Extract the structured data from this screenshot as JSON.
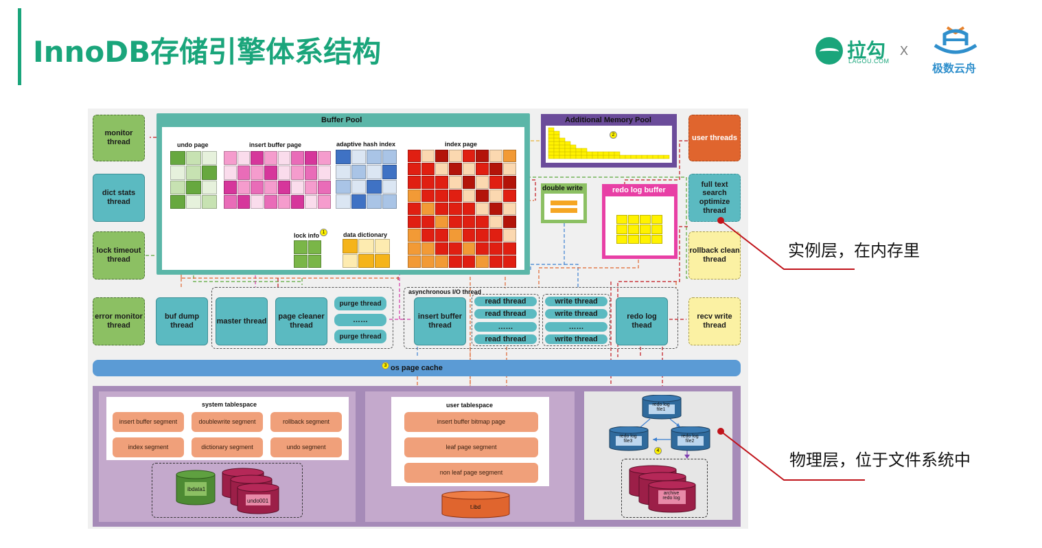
{
  "header": {
    "title": "InnoDB存储引擎体系结构",
    "logo_lagou": "拉勾",
    "logo_lagou_sub": "LAGOU.COM",
    "logo_separator": "X",
    "logo_jishu": "极数云舟"
  },
  "left_threads": {
    "monitor": "monitor thread",
    "dict_stats": "dict stats thread",
    "lock_timeout": "lock timeout thread",
    "error_monitor": "error monitor thread"
  },
  "right_threads": {
    "user": "user threads",
    "full_text": "full text search optimize thread",
    "rollback": "rollback clean thread",
    "recv_write": "recv write thread"
  },
  "buffer_pool": {
    "title": "Buffer Pool",
    "undo_page": "undo page",
    "insert_buffer_page": "insert buffer page",
    "adaptive_hash_index": "adaptive hash index",
    "index_page": "index page",
    "lock_info": "lock info",
    "data_dictionary": "data dictionary"
  },
  "additional_memory_pool": {
    "title": "Additional Memory Pool"
  },
  "double_write": {
    "title": "double write"
  },
  "redo_log_buffer": {
    "title": "redo log buffer"
  },
  "background_threads": {
    "buf_dump": "buf dump thread",
    "master": "master thread",
    "page_cleaner": "page cleaner thread",
    "purge_1": "purge thread",
    "purge_dots": "……",
    "purge_2": "purge thread",
    "async_io_label": "asynchronous I/O thread",
    "insert_buffer": "insert buffer thread",
    "read_1": "read thread",
    "read_2": "read thread",
    "read_dots": "……",
    "read_3": "read thread",
    "write_1": "write thread",
    "write_2": "write thread",
    "write_dots": "……",
    "write_3": "write thread",
    "redo_log": "redo log thead"
  },
  "os_page_cache": {
    "label": "os page cache",
    "marker": "3"
  },
  "markers": {
    "lock_info": "1",
    "memory_pool": "2",
    "redo_file": "4"
  },
  "system_tablespace": {
    "title": "system tablespace",
    "segments": [
      "insert buffer segment",
      "doublewrite segment",
      "rollback segment",
      "index segment",
      "dictionary segment",
      "undo segment"
    ],
    "ibdata": "ibdata1",
    "undo": "undo001"
  },
  "user_tablespace": {
    "title": "user tablespace",
    "segments": [
      "insert buffer bitmap page",
      "leaf page segment",
      "non leaf page segment"
    ],
    "ibd": "t.ibd"
  },
  "redo_files": {
    "file1": "redo log file1",
    "file2": "redo log file2",
    "file3": "redo log file3",
    "archive": "archive redo log"
  },
  "annotations": {
    "instance_layer": "实例层，在内存里",
    "physical_layer": "物理层，位于文件系统中"
  },
  "colors": {
    "brand_green": "#1aa57b",
    "buffer_pool_border": "#5bb6a8",
    "memory_pool": "#6b4c9a",
    "redo_buffer": "#e83fa5",
    "annotation_red": "#c0131a"
  }
}
